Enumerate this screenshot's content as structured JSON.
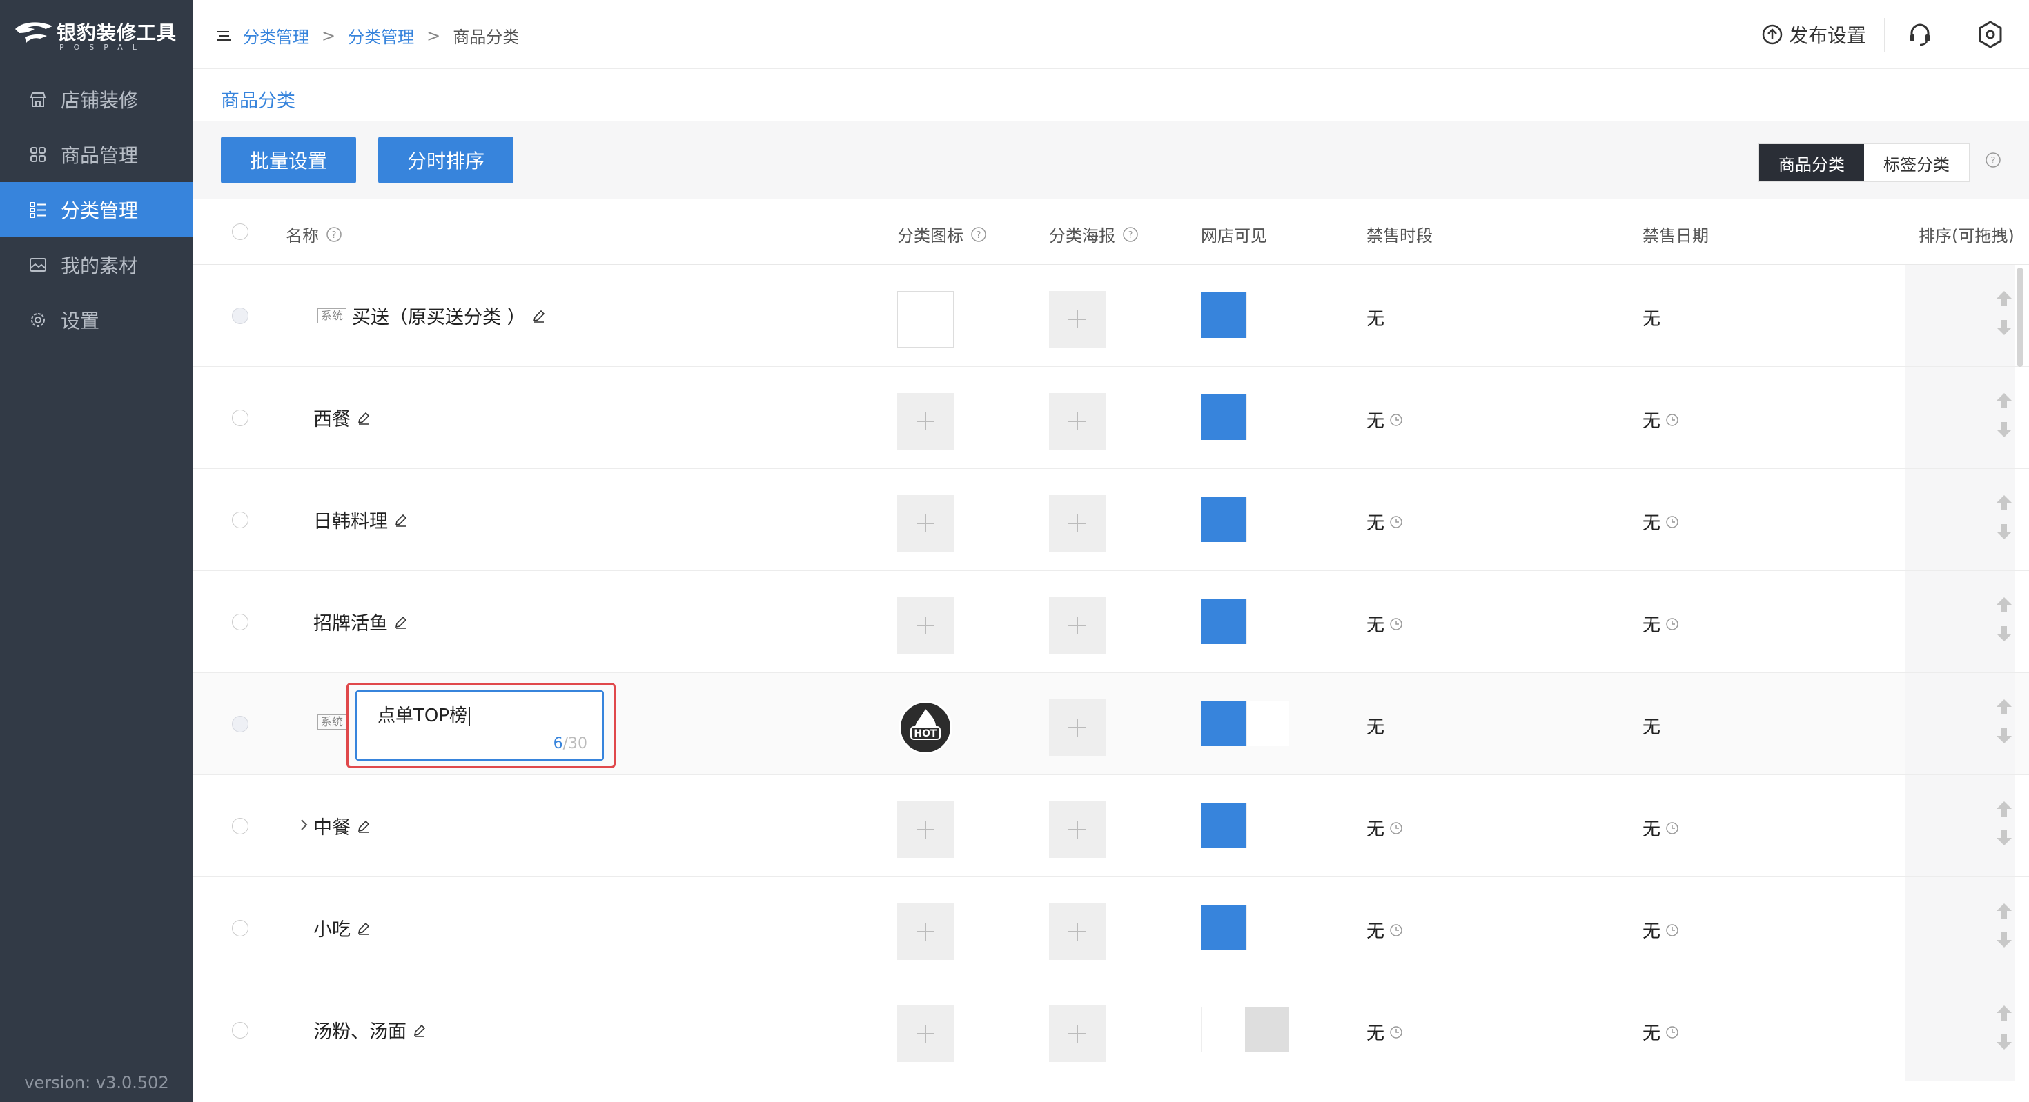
{
  "sidebar": {
    "logo_title": "银豹装修工具",
    "logo_sub": "POSPAL",
    "items": [
      {
        "label": "店铺装修",
        "icon": "store-icon"
      },
      {
        "label": "商品管理",
        "icon": "grid-icon"
      },
      {
        "label": "分类管理",
        "icon": "list-icon",
        "active": true
      },
      {
        "label": "我的素材",
        "icon": "image-icon"
      },
      {
        "label": "设置",
        "icon": "gear-icon"
      }
    ],
    "version": "version: v3.0.502"
  },
  "header": {
    "breadcrumb": [
      "分类管理",
      "分类管理",
      "商品分类"
    ],
    "separator": ">",
    "publish_label": "发布设置"
  },
  "page": {
    "title": "商品分类",
    "batch_button": "批量设置",
    "timed_sort_button": "分时排序",
    "view_tabs": [
      "商品分类",
      "标签分类"
    ]
  },
  "table": {
    "columns": {
      "name": "名称",
      "icon": "分类图标",
      "poster": "分类海报",
      "visible": "网店可见",
      "ban_time": "禁售时段",
      "ban_date": "禁售日期",
      "sort": "排序(可拖拽)"
    },
    "system_tag": "系统",
    "rows": [
      {
        "name": "买送（原买送分类 ）",
        "system": true,
        "icon": "blank",
        "visible": true,
        "ban_time": "无",
        "ban_date": "无",
        "clock": false
      },
      {
        "name": "西餐",
        "system": false,
        "icon": "add",
        "visible": true,
        "ban_time": "无",
        "ban_date": "无",
        "clock": true
      },
      {
        "name": "日韩料理",
        "system": false,
        "icon": "add",
        "visible": true,
        "ban_time": "无",
        "ban_date": "无",
        "clock": true
      },
      {
        "name": "招牌活鱼",
        "system": false,
        "icon": "add",
        "visible": true,
        "ban_time": "无",
        "ban_date": "无",
        "clock": true
      },
      {
        "name": "点单TOP榜",
        "system": true,
        "editing": true,
        "edit_count": "6",
        "edit_max": "/30",
        "icon": "hot",
        "hot_label": "HOT",
        "visible": true,
        "ban_time": "无",
        "ban_date": "无",
        "clock": false
      },
      {
        "name": "中餐",
        "system": false,
        "expandable": true,
        "icon": "add",
        "visible": true,
        "ban_time": "无",
        "ban_date": "无",
        "clock": true
      },
      {
        "name": "小吃",
        "system": false,
        "icon": "add",
        "visible": true,
        "ban_time": "无",
        "ban_date": "无",
        "clock": true
      },
      {
        "name": "汤粉、汤面",
        "system": false,
        "icon": "add",
        "visible": false,
        "ban_time": "无",
        "ban_date": "无",
        "clock": true
      }
    ]
  },
  "colors": {
    "accent": "#3784dc",
    "sidebar_bg": "#323a46",
    "highlight_border": "#e0484b"
  }
}
